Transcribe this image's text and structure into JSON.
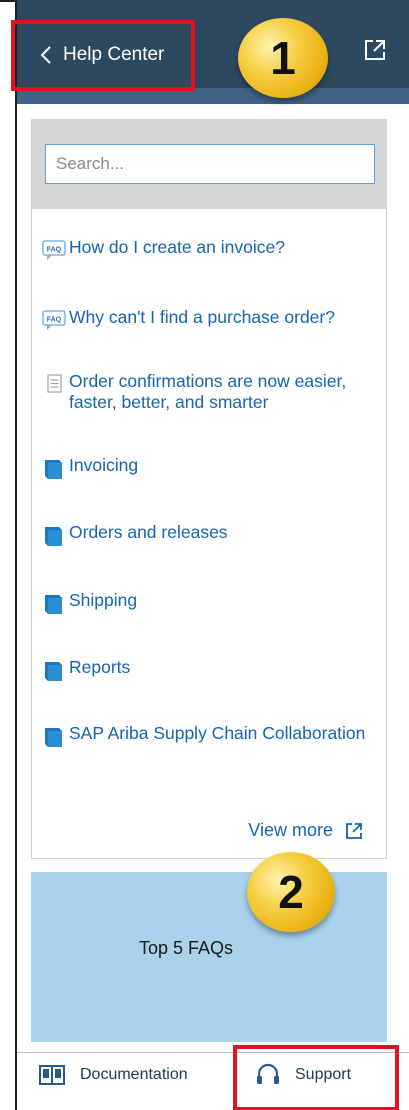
{
  "header": {
    "title": "Help Center",
    "background": "#2d4960",
    "back_icon": "chevron-left-icon",
    "popout_icon": "external-link-icon"
  },
  "callouts": {
    "badge_1": "1",
    "badge_2": "2",
    "highlight_color": "#e0121d"
  },
  "search": {
    "placeholder": "Search..."
  },
  "items": [
    {
      "label": "How do I create an invoice?",
      "icon": "faq-icon"
    },
    {
      "label": "Why can't I find a purchase order?",
      "icon": "faq-icon"
    },
    {
      "label": "Order confirmations are now easier, faster, better, and smarter",
      "icon": "document-icon"
    },
    {
      "label": "Invoicing",
      "icon": "book-icon"
    },
    {
      "label": "Orders and releases",
      "icon": "book-icon"
    },
    {
      "label": "Shipping",
      "icon": "book-icon"
    },
    {
      "label": "Reports",
      "icon": "book-icon"
    },
    {
      "label": "SAP Ariba Supply Chain Collaboration",
      "icon": "book-icon"
    }
  ],
  "view_more": {
    "label": "View more",
    "icon": "external-link-icon"
  },
  "faq": {
    "title": "Top 5 FAQs"
  },
  "footer": {
    "documentation_label": "Documentation",
    "support_label": "Support"
  },
  "colors": {
    "link": "#1565b0",
    "faq_background": "#a9d2ec"
  }
}
